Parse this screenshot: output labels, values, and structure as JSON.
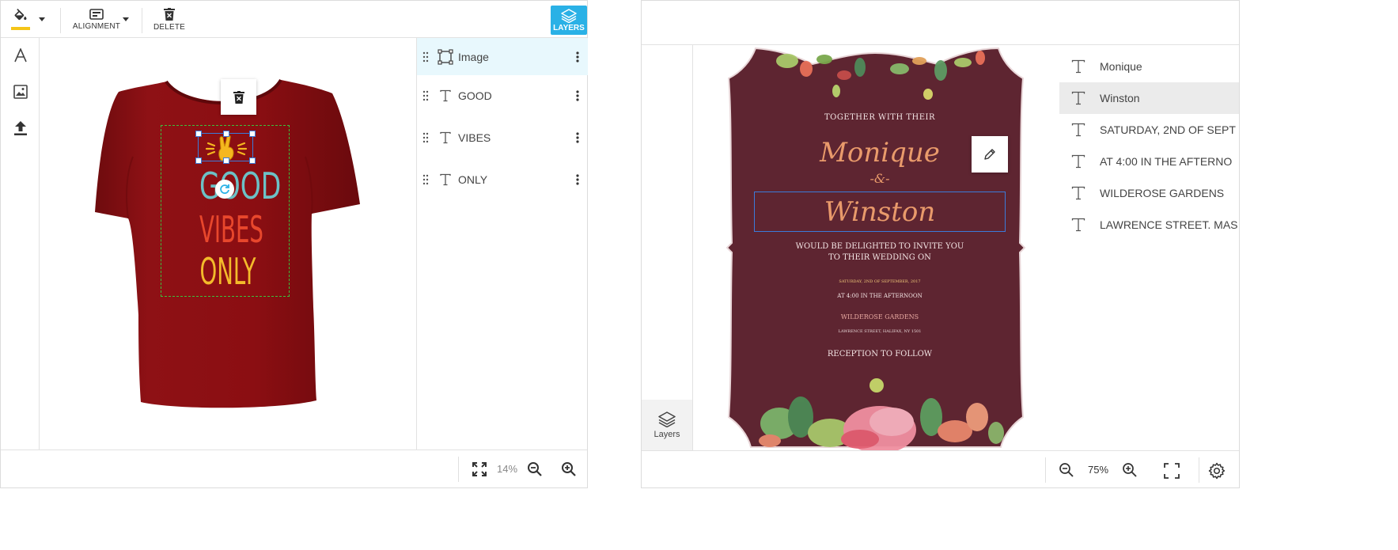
{
  "tshirt_editor": {
    "toolbar": {
      "fill_icon": "paint-bucket-icon",
      "fill_color": "#f5c518",
      "alignment_label": "ALIGNMENT",
      "delete_label": "DELETE",
      "layers_label": "LAYERS"
    },
    "side_tools": [
      "text-tool-icon",
      "image-tool-icon",
      "upload-icon"
    ],
    "design": {
      "line1": "GOOD",
      "line2": "VIBES",
      "line3": "ONLY",
      "shirt_color": "#8b0e12",
      "colors": {
        "good": "#6cc1c6",
        "vibes": "#e8472c",
        "only": "#f3bb2b"
      }
    },
    "layers": [
      {
        "label": "Image",
        "icon": "image-layer-icon",
        "selected": true
      },
      {
        "label": "GOOD",
        "icon": "text-layer-icon",
        "selected": false
      },
      {
        "label": "VIBES",
        "icon": "text-layer-icon",
        "selected": false
      },
      {
        "label": "ONLY",
        "icon": "text-layer-icon",
        "selected": false
      }
    ],
    "footer": {
      "zoom": "14%"
    }
  },
  "invitation_editor": {
    "invitation": {
      "together": "TOGETHER WITH THEIR",
      "name1": "Monique",
      "amp": "-&-",
      "name2": "Winston",
      "invite_line1": "WOULD BE DELIGHTED TO INVITE YOU",
      "invite_line2": "TO THEIR WEDDING ON",
      "date": "SATURDAY, 2ND OF SEPTEMBER, 2017",
      "time": "AT 4:00 IN THE AFTERNOON",
      "venue": "WILDEROSE GARDENS",
      "address": "LAWRENCE STREET, HALIFAX, NY 1501",
      "reception": "RECEPTION TO FOLLOW",
      "card_color": "#5e2531"
    },
    "rail_layers_label": "Layers",
    "layers": [
      {
        "label": "Monique",
        "selected": false
      },
      {
        "label": "Winston",
        "selected": true
      },
      {
        "label": "SATURDAY, 2ND OF SEPT",
        "selected": false
      },
      {
        "label": "AT 4:00 IN THE AFTERNO",
        "selected": false
      },
      {
        "label": "WILDEROSE GARDENS",
        "selected": false
      },
      {
        "label": "LAWRENCE STREET. MAS",
        "selected": false
      }
    ],
    "footer": {
      "zoom": "75%"
    }
  }
}
